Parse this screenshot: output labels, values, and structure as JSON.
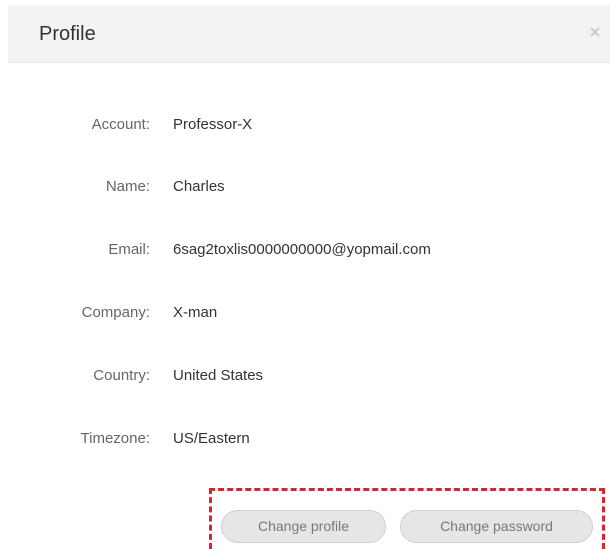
{
  "dialog": {
    "title": "Profile",
    "close_icon": "close-icon"
  },
  "profile": {
    "fields": [
      {
        "label": "Account:",
        "value": "Professor-X"
      },
      {
        "label": "Name:",
        "value": "Charles"
      },
      {
        "label": "Email:",
        "value": "6sag2toxlis0000000000@yopmail.com"
      },
      {
        "label": "Company:",
        "value": "X-man"
      },
      {
        "label": "Country:",
        "value": "United States"
      },
      {
        "label": "Timezone:",
        "value": "US/Eastern"
      }
    ]
  },
  "actions": {
    "change_profile_label": "Change profile",
    "change_password_label": "Change password"
  },
  "colors": {
    "header_bg": "#f1f3f5",
    "highlight_border": "#d9232d",
    "button_bg": "#e6e6e6"
  }
}
